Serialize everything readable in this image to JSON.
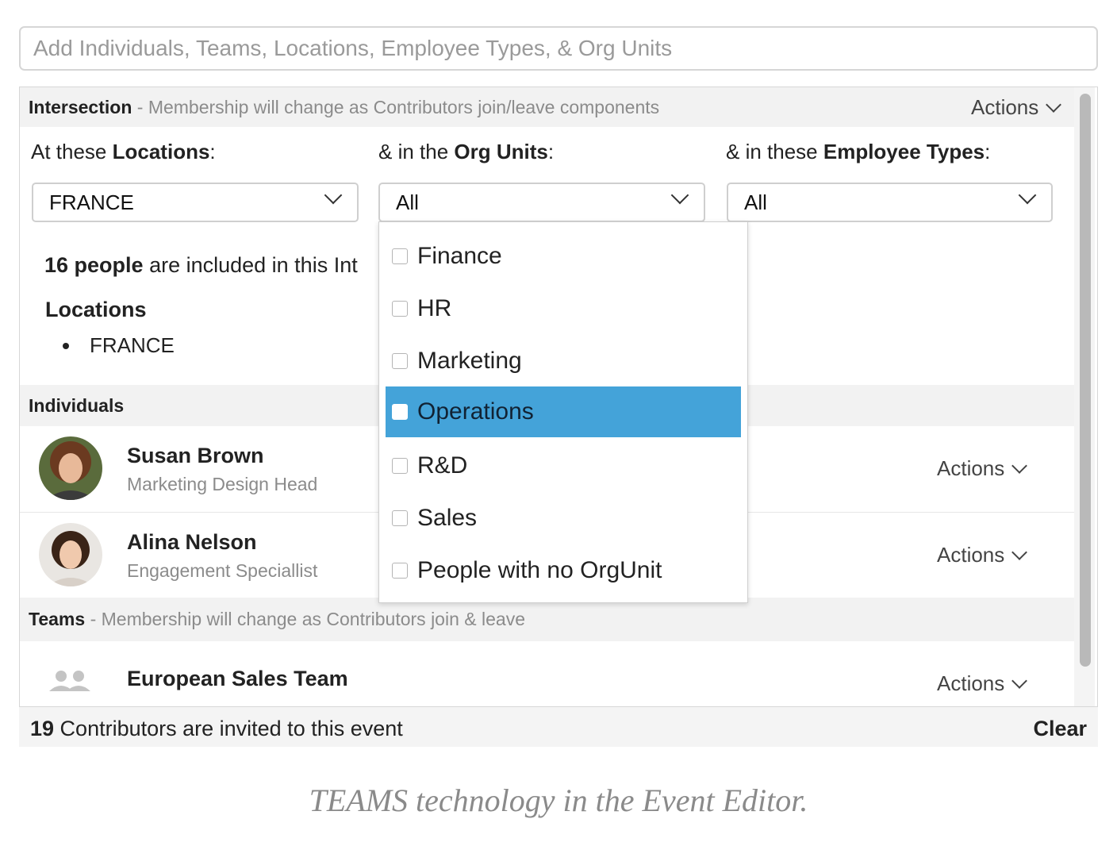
{
  "search": {
    "placeholder": "Add Individuals, Teams, Locations, Employee Types, & Org Units"
  },
  "intersection": {
    "title": "Intersection",
    "subtitle": "- Membership will change as Contributors join/leave components",
    "actions_label": "Actions",
    "filters": [
      {
        "prefix": "At these ",
        "bold": "Locations",
        "suffix": ":",
        "value": "FRANCE"
      },
      {
        "prefix": "& in the ",
        "bold": "Org Units",
        "suffix": ":",
        "value": "All"
      },
      {
        "prefix": "& in these ",
        "bold": "Employee Types",
        "suffix": ":",
        "value": "All"
      }
    ],
    "summary_count": "16 people",
    "summary_rest": "are included in this Int",
    "locations_heading": "Locations",
    "locations": [
      "FRANCE"
    ]
  },
  "individuals": {
    "title": "Individuals",
    "people": [
      {
        "name": "Susan Brown",
        "role": "Marketing Design Head",
        "actions_label": "Actions"
      },
      {
        "name": "Alina Nelson",
        "role": "Engagement Speciallist",
        "actions_label": "Actions"
      }
    ]
  },
  "teams": {
    "title": "Teams",
    "subtitle": "- Membership will change as Contributors join & leave",
    "items": [
      {
        "name": "European Sales Team",
        "actions_label": "Actions"
      }
    ]
  },
  "org_unit_dropdown": {
    "options": [
      "Finance",
      "HR",
      "Marketing",
      "Operations",
      "R&D",
      "Sales",
      "People with no OrgUnit"
    ],
    "highlighted": "Operations"
  },
  "footer": {
    "count": "19",
    "text": " Contributors are invited to this event",
    "clear_label": "Clear"
  },
  "caption": "TEAMS technology in the Event Editor.",
  "colors": {
    "highlight": "#44a3d9",
    "section_bg": "#f2f2f2"
  }
}
